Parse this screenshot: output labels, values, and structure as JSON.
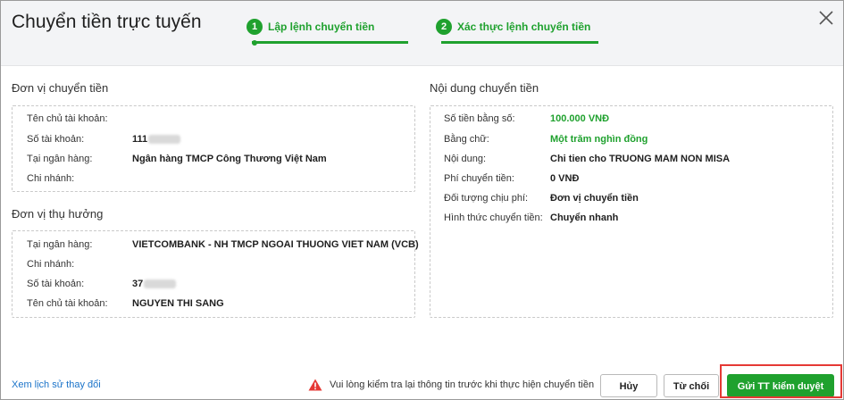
{
  "header": {
    "title": "Chuyển tiền trực tuyến",
    "steps": [
      {
        "number": "1",
        "label": "Lập lệnh chuyển tiền"
      },
      {
        "number": "2",
        "label": "Xác thực lệnh chuyển tiền"
      }
    ]
  },
  "sender": {
    "section_title": "Đơn vị chuyển tiền",
    "rows": [
      {
        "label": "Tên chủ tài khoản:",
        "value": ""
      },
      {
        "label": "Số tài khoản:",
        "value": "111"
      },
      {
        "label": "Tại ngân hàng:",
        "value": "Ngân hàng TMCP Công Thương Việt Nam"
      },
      {
        "label": "Chi nhánh:",
        "value": ""
      }
    ]
  },
  "beneficiary": {
    "section_title": "Đơn vị thụ hưởng",
    "rows": [
      {
        "label": "Tại ngân hàng:",
        "value": "VIETCOMBANK - NH TMCP NGOAI THUONG VIET NAM (VCB)"
      },
      {
        "label": "Chi nhánh:",
        "value": ""
      },
      {
        "label": "Số tài khoản:",
        "value": "37"
      },
      {
        "label": "Tên chủ tài khoản:",
        "value": "NGUYEN THI SANG"
      }
    ]
  },
  "content": {
    "section_title": "Nội dung chuyển tiền",
    "rows": [
      {
        "label": "Số tiền bằng số:",
        "value": "100.000 VNĐ"
      },
      {
        "label": "Bằng chữ:",
        "value": "Một trăm nghìn đồng"
      },
      {
        "label": "Nội dung:",
        "value": "Chi tien cho TRUONG MAM NON MISA"
      },
      {
        "label": "Phí chuyển tiền:",
        "value": "0 VNĐ"
      },
      {
        "label": "Đối tượng chịu phí:",
        "value": "Đơn vị chuyển tiền"
      },
      {
        "label": "Hình thức chuyển tiền:",
        "value": "Chuyển nhanh"
      }
    ]
  },
  "footer": {
    "history_link": "Xem lịch sử thay đổi",
    "warning": "Vui lòng kiểm tra lại thông tin trước khi thực hiện chuyển tiền",
    "cancel_label": "Hủy",
    "reject_label": "Từ chối",
    "submit_label": "Gửi TT kiểm duyệt"
  },
  "colors": {
    "accent": "#1fa12e",
    "link": "#1a73c9",
    "warning": "#e53935",
    "highlight": "#e53935"
  }
}
